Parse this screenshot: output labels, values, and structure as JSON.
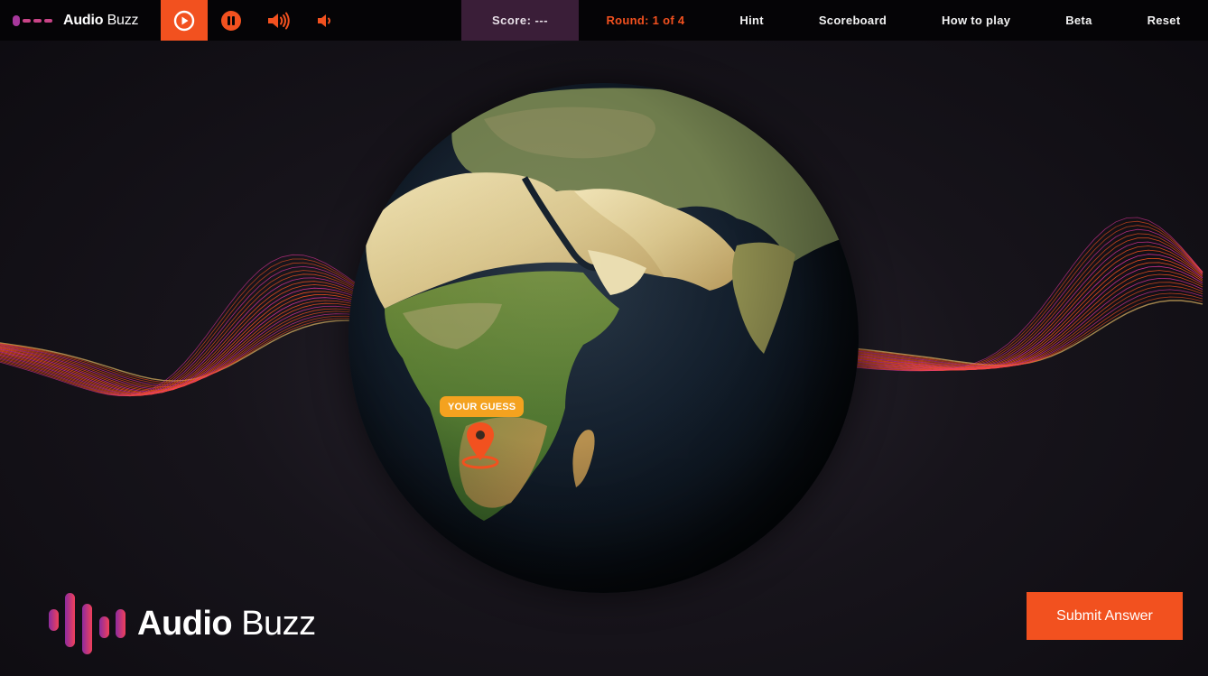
{
  "app": {
    "name_bold": "Audio",
    "name_light": "Buzz"
  },
  "controls": {
    "play_icon": "play-circle-icon",
    "pause_icon": "pause-circle-icon",
    "volume_up_icon": "volume-up-icon",
    "volume_down_icon": "volume-down-icon"
  },
  "score": {
    "label": "Score: ---"
  },
  "nav": {
    "round": "Round: 1 of 4",
    "hint": "Hint",
    "scoreboard": "Scoreboard",
    "how_to_play": "How to play",
    "beta": "Beta",
    "reset": "Reset"
  },
  "map": {
    "guess_label": "YOUR GUESS",
    "marker_icon": "map-pin-icon"
  },
  "footer": {
    "submit_label": "Submit Answer"
  },
  "colors": {
    "accent": "#f2511f",
    "badge": "#f4a21f",
    "score_bg": "#3a1e38",
    "wave_pink": "#e0349a",
    "wave_yellow": "#f3c66a"
  }
}
